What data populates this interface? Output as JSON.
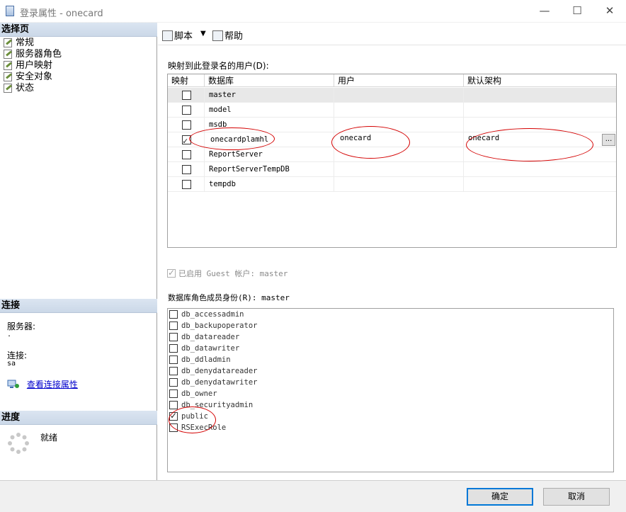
{
  "window": {
    "title": "登录属性 - onecard",
    "minimize": "—",
    "maximize": "☐",
    "close": "✕"
  },
  "left": {
    "select_page_header": "选择页",
    "pages": [
      {
        "label": "常规"
      },
      {
        "label": "服务器角色"
      },
      {
        "label": "用户映射"
      },
      {
        "label": "安全对象"
      },
      {
        "label": "状态"
      }
    ],
    "connection_header": "连接",
    "server_label": "服务器:",
    "server_value": ".",
    "connection_label": "连接:",
    "connection_value": "sa",
    "view_connection_link": "查看连接属性",
    "progress_header": "进度",
    "progress_status": "就绪"
  },
  "toolbar": {
    "script_label": "脚本",
    "help_label": "帮助"
  },
  "mapping": {
    "label": "映射到此登录名的用户(D):",
    "columns": [
      "映射",
      "数据库",
      "用户",
      "默认架构"
    ],
    "rows": [
      {
        "mapped": false,
        "database": "master",
        "user": "",
        "schema": ""
      },
      {
        "mapped": false,
        "database": "model",
        "user": "",
        "schema": ""
      },
      {
        "mapped": false,
        "database": "msdb",
        "user": "",
        "schema": ""
      },
      {
        "mapped": true,
        "database": "onecardplamhl",
        "user": "onecard",
        "schema": "onecard"
      },
      {
        "mapped": false,
        "database": "ReportServer",
        "user": "",
        "schema": ""
      },
      {
        "mapped": false,
        "database": "ReportServerTempDB",
        "user": "",
        "schema": ""
      },
      {
        "mapped": false,
        "database": "tempdb",
        "user": "",
        "schema": ""
      }
    ],
    "ellipsis": "..."
  },
  "guest": {
    "checked": true,
    "label": "已启用 Guest 帐户: master"
  },
  "roles": {
    "label": "数据库角色成员身份(R): master",
    "items": [
      {
        "name": "db_accessadmin",
        "checked": false
      },
      {
        "name": "db_backupoperator",
        "checked": false
      },
      {
        "name": "db_datareader",
        "checked": false
      },
      {
        "name": "db_datawriter",
        "checked": false
      },
      {
        "name": "db_ddladmin",
        "checked": false
      },
      {
        "name": "db_denydatareader",
        "checked": false
      },
      {
        "name": "db_denydatawriter",
        "checked": false
      },
      {
        "name": "db_owner",
        "checked": false
      },
      {
        "name": "db_securityadmin",
        "checked": false
      },
      {
        "name": "public",
        "checked": true
      },
      {
        "name": "RSExecRole",
        "checked": false
      }
    ]
  },
  "footer": {
    "ok": "确定",
    "cancel": "取消"
  }
}
